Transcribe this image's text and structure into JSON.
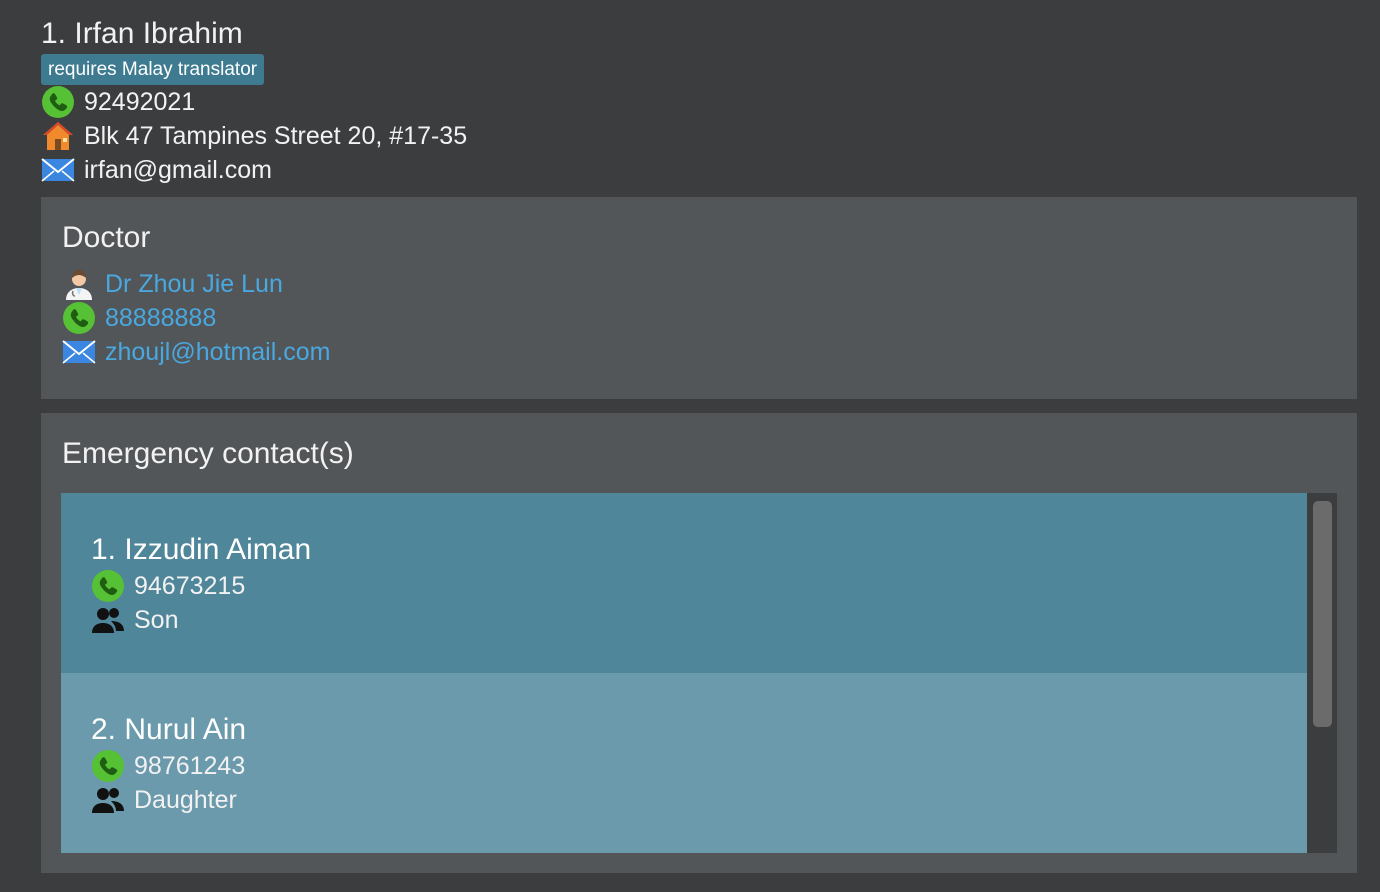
{
  "patient": {
    "name": "1. Irfan Ibrahim",
    "tag": "requires Malay translator",
    "phone": "92492021",
    "address": "Blk 47 Tampines Street 20, #17-35",
    "email": "irfan@gmail.com"
  },
  "doctor": {
    "title": "Doctor",
    "name": "Dr Zhou Jie Lun",
    "phone": "88888888",
    "email": "zhoujl@hotmail.com"
  },
  "emergency": {
    "title": "Emergency contact(s)",
    "contacts": [
      {
        "name": "1. Izzudin Aiman",
        "phone": "94673215",
        "relation": "Son"
      },
      {
        "name": "2. Nurul Ain",
        "phone": "98761243",
        "relation": "Daughter"
      }
    ]
  },
  "icons": {
    "phone": "phone-icon",
    "home": "home-icon",
    "email": "envelope-icon",
    "doctor": "doctor-avatar-icon",
    "relation": "people-icon"
  },
  "colors": {
    "background": "#3c3d3f",
    "card": "#525659",
    "tag": "#3e7b91",
    "link": "#4aa8e0",
    "selected_row": "#4f8699",
    "alt_row": "#6a9aab"
  }
}
